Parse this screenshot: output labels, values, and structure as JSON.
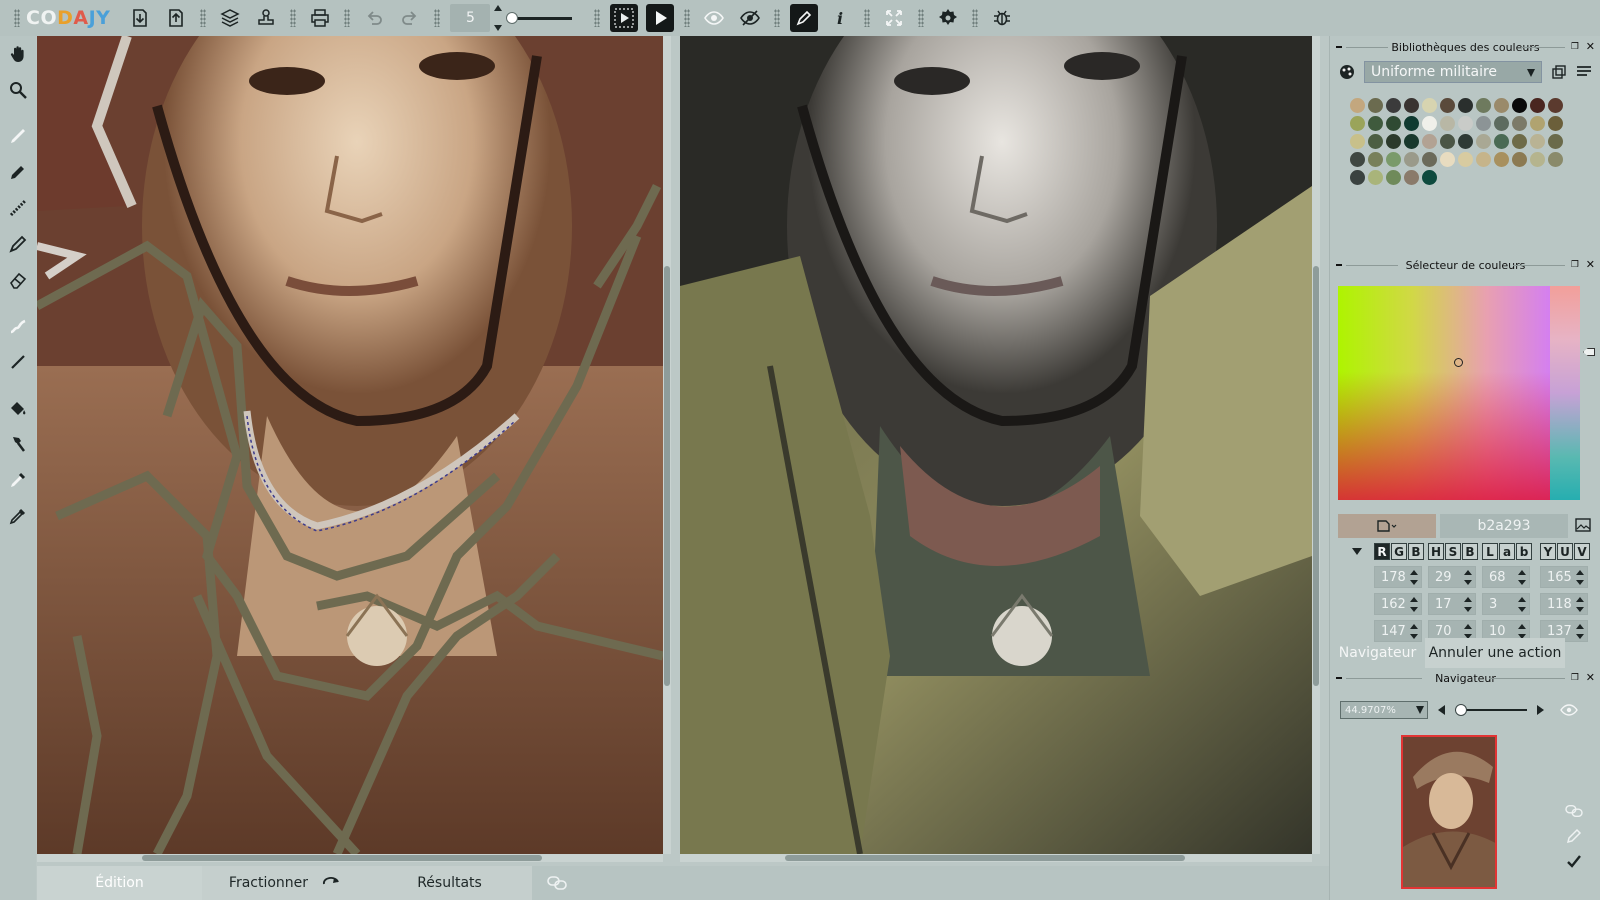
{
  "app": {
    "logo": {
      "c1": "CO",
      "c2": "D",
      "c3": "A",
      "c4": "JY"
    },
    "brush_size": "5"
  },
  "toolbar": {
    "icons": [
      "import-icon",
      "export-icon",
      "layers-icon",
      "stamp-icon",
      "print-icon",
      "undo-icon",
      "redo-icon",
      "preview-play-icon",
      "play-icon",
      "eye-icon",
      "eye-hidden-icon",
      "pen-mode-icon",
      "info-icon",
      "fullscreen-icon",
      "settings-icon",
      "bug-icon"
    ]
  },
  "tools": [
    "hand-icon",
    "zoom-icon",
    "brush-icon",
    "pencil-icon",
    "dotted-brush-icon",
    "marker-icon",
    "eraser-icon",
    "smudge-icon",
    "line-icon",
    "fill-bucket-icon",
    "hammer-icon",
    "eyedropper-fill-icon",
    "eyedropper-icon"
  ],
  "bottom_tabs": {
    "edition": "Édition",
    "fractionner": "Fractionner",
    "resultats": "Résultats"
  },
  "libraries": {
    "title": "Bibliothèques des couleurs",
    "selected": "Uniforme militaire",
    "swatches": [
      "#c3a77e",
      "#6b6b4f",
      "#3b3b3b",
      "#3a3431",
      "#d7d4b0",
      "#5a4a3b",
      "#2a2f2d",
      "#6e7a5e",
      "#9a8a6a",
      "#0a0a0a",
      "#4a2620",
      "#5b3a2e",
      "#9aa45a",
      "#3f5a3d",
      "#2f4a33",
      "#0f3a30",
      "#f0f0ea",
      "#b8b7a5",
      "#c9cbc8",
      "#8c9496",
      "#5d6b5f",
      "#7c7a68",
      "#b0a370",
      "#6b5f3a",
      "#c8c08a",
      "#4c5e42",
      "#2c3a2b",
      "#18382c",
      "#b2a293",
      "#4a5545",
      "#2e3a35",
      "#a9a894",
      "#4a6a54",
      "#6e6b48",
      "#b9b394",
      "#6a6a4a",
      "#3f4741",
      "#78805a",
      "#7a9a6a",
      "#9a9a8a",
      "#6b6a5a",
      "#e8dcc0",
      "#d8cba0",
      "#c6b48a",
      "#a8905e",
      "#8c7a52",
      "#b5b48e",
      "#8a8a6a",
      "#3a4240",
      "#a9b47a",
      "#6f8a5a",
      "#8a7a6a",
      "#0e4a3e"
    ]
  },
  "selector": {
    "title": "Sélecteur de couleurs",
    "hex": "b2a293",
    "models": [
      [
        "R",
        "G",
        "B"
      ],
      [
        "H",
        "S",
        "B"
      ],
      [
        "L",
        "a",
        "b"
      ],
      [
        "Y",
        "U",
        "V"
      ]
    ],
    "values": [
      [
        "178",
        "29",
        "68",
        "165"
      ],
      [
        "162",
        "17",
        "3",
        "118"
      ],
      [
        "147",
        "70",
        "10",
        "137"
      ]
    ]
  },
  "navigator": {
    "tab_navigator": "Navigateur",
    "tab_undo": "Annuler une action",
    "title": "Navigateur",
    "zoom": "44.9707%"
  },
  "colors": {
    "accent": "#e23434",
    "current": "#b2a293"
  }
}
